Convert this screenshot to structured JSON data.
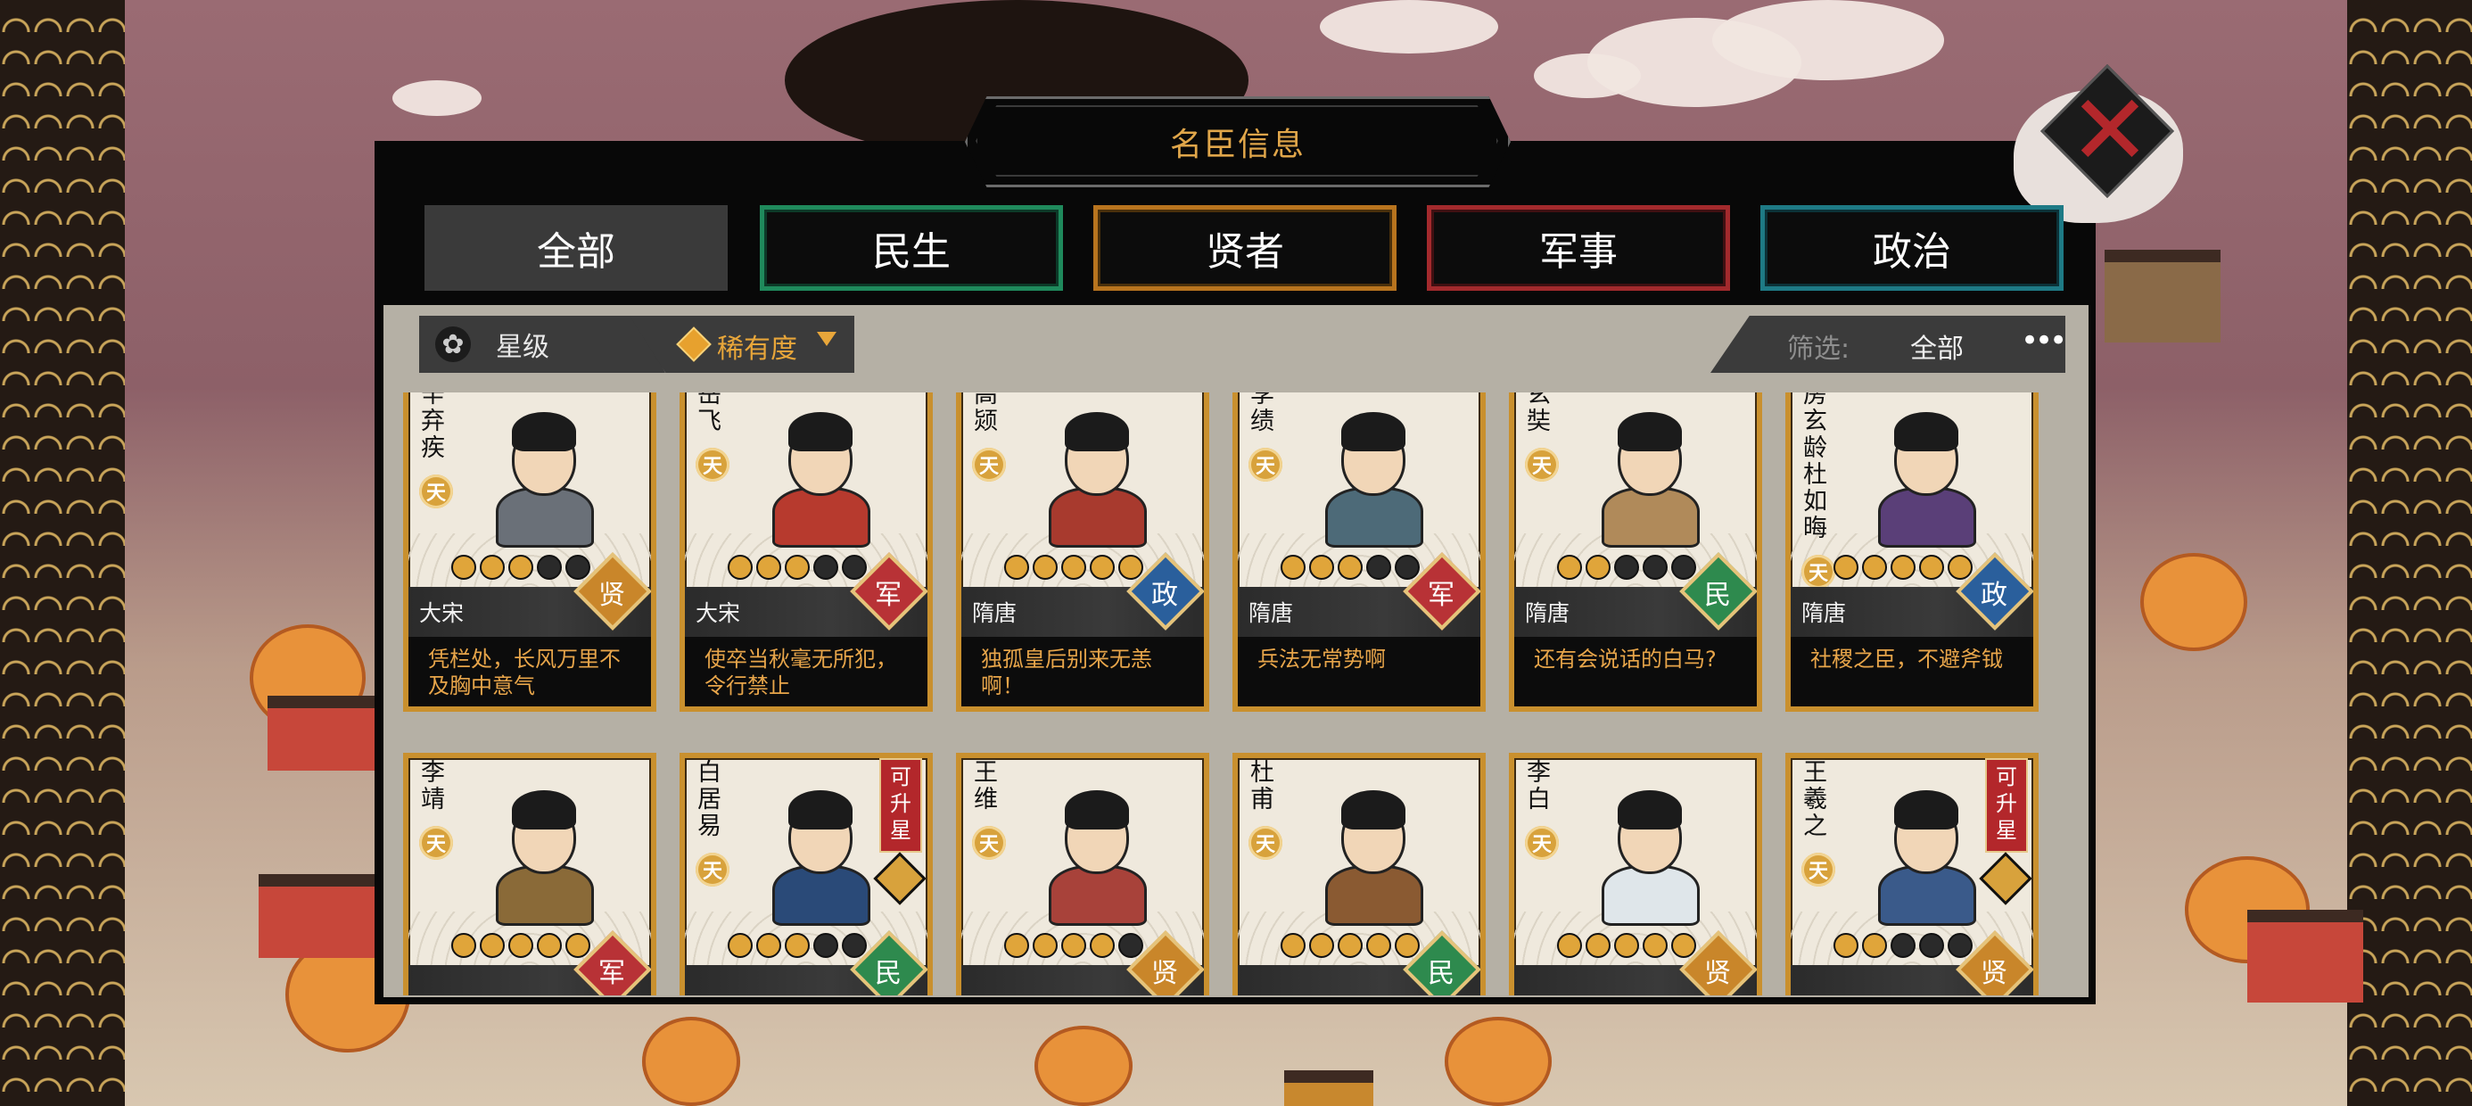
{
  "window": {
    "title": "名臣信息"
  },
  "tabs": [
    {
      "label": "全部",
      "active": true,
      "color": "#3a3a3a"
    },
    {
      "label": "民生",
      "active": false,
      "color": "#1f8a5c"
    },
    {
      "label": "贤者",
      "active": false,
      "color": "#b8741e"
    },
    {
      "label": "军事",
      "active": false,
      "color": "#a32a2d"
    },
    {
      "label": "政治",
      "active": false,
      "color": "#1e7a85"
    }
  ],
  "toolbar": {
    "star_sort": "星级",
    "rarity_sort": "稀有度",
    "filter_label": "筛选:",
    "filter_value": "全部",
    "more": "•••"
  },
  "type_colors": {
    "贤": "#c9862a",
    "军": "#b83236",
    "政": "#2a5f9c",
    "民": "#2e8a4e"
  },
  "ministers": [
    {
      "name": "辛弃疾",
      "rarity": "天",
      "stars": 3,
      "dynasty": "大宋",
      "type": "贤",
      "quote": "凭栏处，长风万里不及胸中意气",
      "body_color": "#6a7078"
    },
    {
      "name": "岳飞",
      "rarity": "天",
      "stars": 3,
      "dynasty": "大宋",
      "type": "军",
      "quote": "使卒当秋毫无所犯，令行禁止",
      "body_color": "#b73a2e"
    },
    {
      "name": "高颎",
      "rarity": "天",
      "stars": 5,
      "dynasty": "隋唐",
      "type": "政",
      "quote": "独孤皇后别来无恙啊！",
      "body_color": "#a83a2e"
    },
    {
      "name": "李绩",
      "rarity": "天",
      "stars": 3,
      "dynasty": "隋唐",
      "type": "军",
      "quote": "兵法无常势啊",
      "body_color": "#4d6a78"
    },
    {
      "name": "玄奘",
      "rarity": "天",
      "stars": 2,
      "dynasty": "隋唐",
      "type": "民",
      "quote": "还有会说话的白马?",
      "body_color": "#b08a5a"
    },
    {
      "name": "房玄龄杜如晦",
      "rarity": "天",
      "stars": 5,
      "dynasty": "隋唐",
      "type": "政",
      "quote": "社稷之臣，不避斧钺",
      "body_color": "#5a3f78"
    },
    {
      "name": "李靖",
      "rarity": "天",
      "stars": 5,
      "dynasty": "",
      "type": "军",
      "quote": "",
      "body_color": "#8a6a38",
      "upgradable": false
    },
    {
      "name": "白居易",
      "rarity": "天",
      "stars": 3,
      "dynasty": "",
      "type": "民",
      "quote": "",
      "body_color": "#2a4a78",
      "upgradable": true,
      "upgrade_label": "可升星"
    },
    {
      "name": "王维",
      "rarity": "天",
      "stars": 4,
      "dynasty": "",
      "type": "贤",
      "quote": "",
      "body_color": "#a8423a",
      "upgradable": false
    },
    {
      "name": "杜甫",
      "rarity": "天",
      "stars": 5,
      "dynasty": "",
      "type": "民",
      "quote": "",
      "body_color": "#8a5a32",
      "upgradable": false
    },
    {
      "name": "李白",
      "rarity": "天",
      "stars": 5,
      "dynasty": "",
      "type": "贤",
      "quote": "",
      "body_color": "#dfe6ea",
      "upgradable": false
    },
    {
      "name": "王羲之",
      "rarity": "天",
      "stars": 2,
      "dynasty": "",
      "type": "贤",
      "quote": "",
      "body_color": "#3a5a8a",
      "upgradable": true,
      "upgrade_label": "可升星"
    }
  ]
}
